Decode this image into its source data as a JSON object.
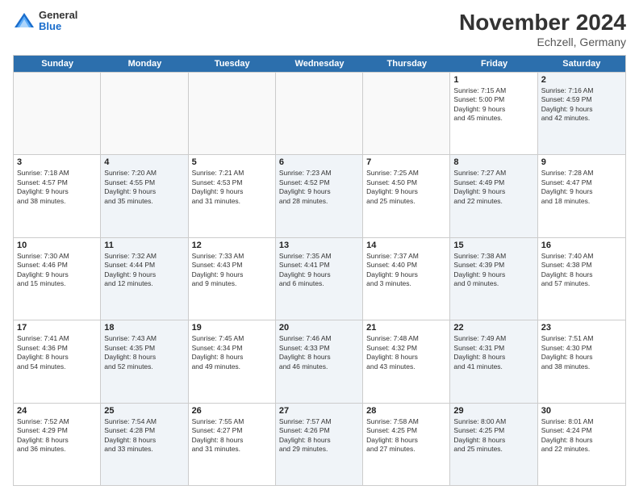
{
  "header": {
    "logo_general": "General",
    "logo_blue": "Blue",
    "month_title": "November 2024",
    "location": "Echzell, Germany"
  },
  "weekdays": [
    "Sunday",
    "Monday",
    "Tuesday",
    "Wednesday",
    "Thursday",
    "Friday",
    "Saturday"
  ],
  "rows": [
    [
      {
        "day": "",
        "info": "",
        "shaded": false,
        "empty": true
      },
      {
        "day": "",
        "info": "",
        "shaded": false,
        "empty": true
      },
      {
        "day": "",
        "info": "",
        "shaded": false,
        "empty": true
      },
      {
        "day": "",
        "info": "",
        "shaded": false,
        "empty": true
      },
      {
        "day": "",
        "info": "",
        "shaded": false,
        "empty": true
      },
      {
        "day": "1",
        "info": "Sunrise: 7:15 AM\nSunset: 5:00 PM\nDaylight: 9 hours\nand 45 minutes.",
        "shaded": false,
        "empty": false
      },
      {
        "day": "2",
        "info": "Sunrise: 7:16 AM\nSunset: 4:59 PM\nDaylight: 9 hours\nand 42 minutes.",
        "shaded": true,
        "empty": false
      }
    ],
    [
      {
        "day": "3",
        "info": "Sunrise: 7:18 AM\nSunset: 4:57 PM\nDaylight: 9 hours\nand 38 minutes.",
        "shaded": false,
        "empty": false
      },
      {
        "day": "4",
        "info": "Sunrise: 7:20 AM\nSunset: 4:55 PM\nDaylight: 9 hours\nand 35 minutes.",
        "shaded": true,
        "empty": false
      },
      {
        "day": "5",
        "info": "Sunrise: 7:21 AM\nSunset: 4:53 PM\nDaylight: 9 hours\nand 31 minutes.",
        "shaded": false,
        "empty": false
      },
      {
        "day": "6",
        "info": "Sunrise: 7:23 AM\nSunset: 4:52 PM\nDaylight: 9 hours\nand 28 minutes.",
        "shaded": true,
        "empty": false
      },
      {
        "day": "7",
        "info": "Sunrise: 7:25 AM\nSunset: 4:50 PM\nDaylight: 9 hours\nand 25 minutes.",
        "shaded": false,
        "empty": false
      },
      {
        "day": "8",
        "info": "Sunrise: 7:27 AM\nSunset: 4:49 PM\nDaylight: 9 hours\nand 22 minutes.",
        "shaded": true,
        "empty": false
      },
      {
        "day": "9",
        "info": "Sunrise: 7:28 AM\nSunset: 4:47 PM\nDaylight: 9 hours\nand 18 minutes.",
        "shaded": false,
        "empty": false
      }
    ],
    [
      {
        "day": "10",
        "info": "Sunrise: 7:30 AM\nSunset: 4:46 PM\nDaylight: 9 hours\nand 15 minutes.",
        "shaded": false,
        "empty": false
      },
      {
        "day": "11",
        "info": "Sunrise: 7:32 AM\nSunset: 4:44 PM\nDaylight: 9 hours\nand 12 minutes.",
        "shaded": true,
        "empty": false
      },
      {
        "day": "12",
        "info": "Sunrise: 7:33 AM\nSunset: 4:43 PM\nDaylight: 9 hours\nand 9 minutes.",
        "shaded": false,
        "empty": false
      },
      {
        "day": "13",
        "info": "Sunrise: 7:35 AM\nSunset: 4:41 PM\nDaylight: 9 hours\nand 6 minutes.",
        "shaded": true,
        "empty": false
      },
      {
        "day": "14",
        "info": "Sunrise: 7:37 AM\nSunset: 4:40 PM\nDaylight: 9 hours\nand 3 minutes.",
        "shaded": false,
        "empty": false
      },
      {
        "day": "15",
        "info": "Sunrise: 7:38 AM\nSunset: 4:39 PM\nDaylight: 9 hours\nand 0 minutes.",
        "shaded": true,
        "empty": false
      },
      {
        "day": "16",
        "info": "Sunrise: 7:40 AM\nSunset: 4:38 PM\nDaylight: 8 hours\nand 57 minutes.",
        "shaded": false,
        "empty": false
      }
    ],
    [
      {
        "day": "17",
        "info": "Sunrise: 7:41 AM\nSunset: 4:36 PM\nDaylight: 8 hours\nand 54 minutes.",
        "shaded": false,
        "empty": false
      },
      {
        "day": "18",
        "info": "Sunrise: 7:43 AM\nSunset: 4:35 PM\nDaylight: 8 hours\nand 52 minutes.",
        "shaded": true,
        "empty": false
      },
      {
        "day": "19",
        "info": "Sunrise: 7:45 AM\nSunset: 4:34 PM\nDaylight: 8 hours\nand 49 minutes.",
        "shaded": false,
        "empty": false
      },
      {
        "day": "20",
        "info": "Sunrise: 7:46 AM\nSunset: 4:33 PM\nDaylight: 8 hours\nand 46 minutes.",
        "shaded": true,
        "empty": false
      },
      {
        "day": "21",
        "info": "Sunrise: 7:48 AM\nSunset: 4:32 PM\nDaylight: 8 hours\nand 43 minutes.",
        "shaded": false,
        "empty": false
      },
      {
        "day": "22",
        "info": "Sunrise: 7:49 AM\nSunset: 4:31 PM\nDaylight: 8 hours\nand 41 minutes.",
        "shaded": true,
        "empty": false
      },
      {
        "day": "23",
        "info": "Sunrise: 7:51 AM\nSunset: 4:30 PM\nDaylight: 8 hours\nand 38 minutes.",
        "shaded": false,
        "empty": false
      }
    ],
    [
      {
        "day": "24",
        "info": "Sunrise: 7:52 AM\nSunset: 4:29 PM\nDaylight: 8 hours\nand 36 minutes.",
        "shaded": false,
        "empty": false
      },
      {
        "day": "25",
        "info": "Sunrise: 7:54 AM\nSunset: 4:28 PM\nDaylight: 8 hours\nand 33 minutes.",
        "shaded": true,
        "empty": false
      },
      {
        "day": "26",
        "info": "Sunrise: 7:55 AM\nSunset: 4:27 PM\nDaylight: 8 hours\nand 31 minutes.",
        "shaded": false,
        "empty": false
      },
      {
        "day": "27",
        "info": "Sunrise: 7:57 AM\nSunset: 4:26 PM\nDaylight: 8 hours\nand 29 minutes.",
        "shaded": true,
        "empty": false
      },
      {
        "day": "28",
        "info": "Sunrise: 7:58 AM\nSunset: 4:25 PM\nDaylight: 8 hours\nand 27 minutes.",
        "shaded": false,
        "empty": false
      },
      {
        "day": "29",
        "info": "Sunrise: 8:00 AM\nSunset: 4:25 PM\nDaylight: 8 hours\nand 25 minutes.",
        "shaded": true,
        "empty": false
      },
      {
        "day": "30",
        "info": "Sunrise: 8:01 AM\nSunset: 4:24 PM\nDaylight: 8 hours\nand 22 minutes.",
        "shaded": false,
        "empty": false
      }
    ]
  ]
}
